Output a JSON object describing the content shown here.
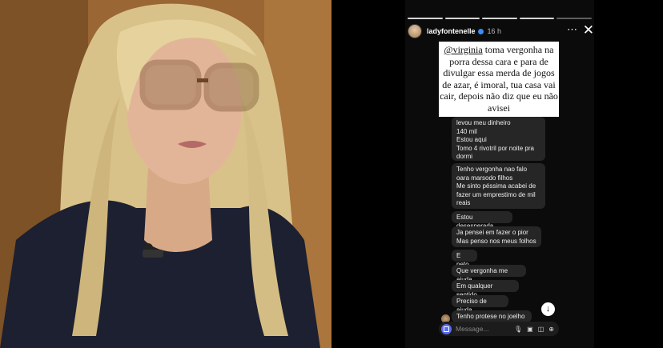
{
  "story": {
    "username": "ladyfontenelle",
    "time": "16 h",
    "progress_total": 5,
    "progress_done": 4,
    "more_icon": "⋯",
    "close_icon": "✕"
  },
  "caption": {
    "mention": "@virginia",
    "text": " toma vergonha na porra dessa cara e para de divulgar essa merda de jogos de azar, é imoral, tua casa vai cair, depois não diz que eu não avisei"
  },
  "messages": [
    "levou meu dinheiro\n140 mil\nEstou aqui\nTomo 4 rivotril  por noite pra dormi",
    "Tenho vergonha nao falo oara marsodo filhos\nMe sinto péssima  acabei de fazer um emprestimo de mil reais",
    "Estou desesperada",
    "Ja pensei em fazer o pior\nMas penso nos meus folhos",
    "E neto",
    "Que vergonha me ajuda",
    "Em qualquer sentido",
    "Preciso de ajuda",
    "Tenho protese no joelho"
  ],
  "composer": {
    "placeholder": "Message..."
  },
  "colors": {
    "bubble": "#262626",
    "camera_button": "#5b6cf0",
    "verified": "#3a8ef5"
  }
}
